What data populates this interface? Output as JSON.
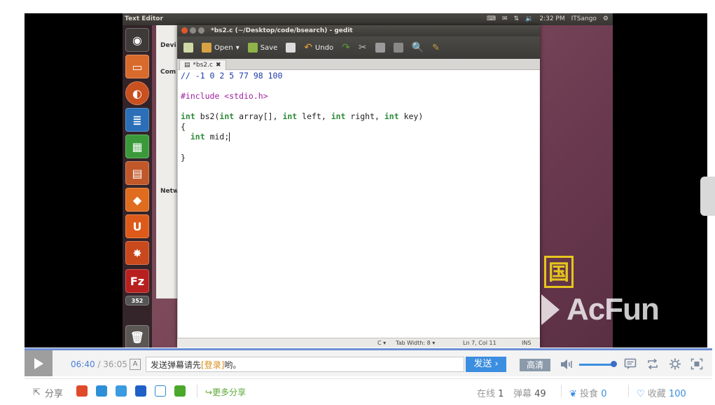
{
  "desktop": {
    "topbar_title": "Text Editor",
    "clock": "2:32 PM",
    "user": "ITSango"
  },
  "bg_window": {
    "labels": [
      "Devi",
      "Com",
      "Netw"
    ]
  },
  "gedit": {
    "window_title": "*bs2.c (~/Desktop/code/bsearch) - gedit",
    "toolbar": {
      "open_label": "Open",
      "save_label": "Save",
      "undo_label": "Undo"
    },
    "tab_label": "*bs2.c",
    "code": {
      "line1": "// -1 0 2 5 77 98 100",
      "line2": "#include <stdio.h>",
      "line3_fn": " bs2(",
      "line3_a": " array[], ",
      "line3_b": " left, ",
      "line3_c": " right, ",
      "line3_d": " key)",
      "kw_int": "int",
      "line4": "{",
      "line5_rest": " mid;",
      "line6": "}"
    },
    "status": {
      "lang": "C ▾",
      "tab_width": "Tab Width: 8 ▾",
      "position": "Ln 7, Col 11",
      "mode": "INS"
    }
  },
  "overlay": {
    "logo_glyph": "国",
    "watermark": "AcFun"
  },
  "player": {
    "current_time": "06:40",
    "time_sep": " / ",
    "duration": "36:05",
    "danmu_mode_label": "A",
    "danmu_prompt_pre": "发送弹幕请先",
    "danmu_prompt_login": "[登录]",
    "danmu_prompt_post": "哟。",
    "send_label": "发送",
    "quality_label": "高清",
    "volume_level": 0.9
  },
  "share": {
    "share_label": "分享",
    "more_share_label": "更多分享",
    "online_label": "在线",
    "online_count": "1",
    "danmu_label": "弹幕",
    "danmu_count": "49",
    "feed_label": "投食",
    "feed_count": "0",
    "fav_label": "收藏",
    "fav_count": "100"
  },
  "colors": {
    "accent": "#3b8ee0",
    "login_link": "#d98c1a",
    "ubuntu_close": "#e0572b"
  }
}
